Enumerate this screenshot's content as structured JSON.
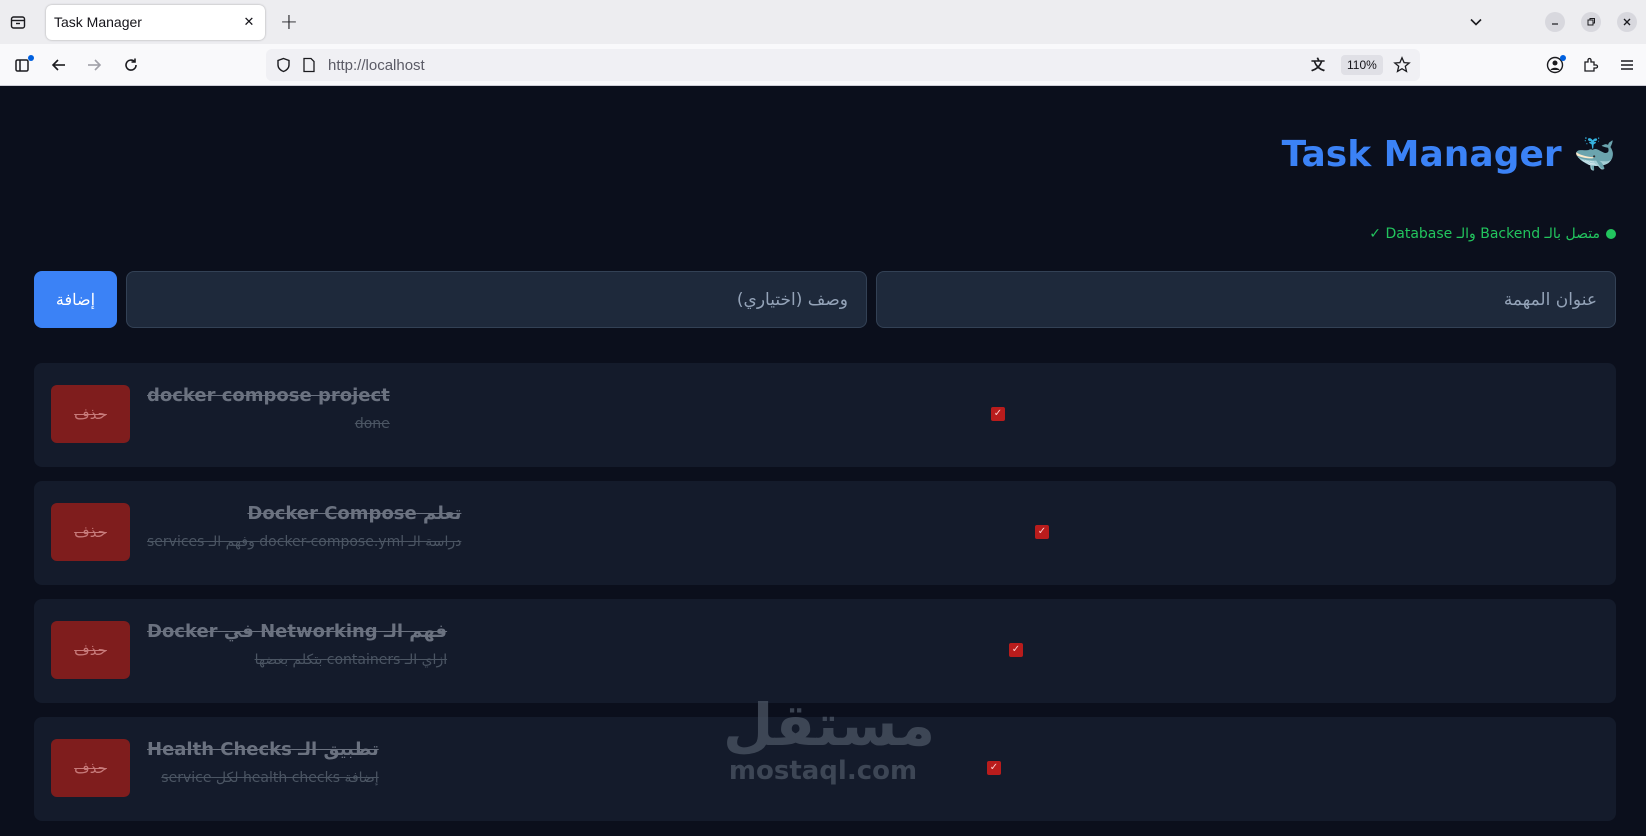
{
  "browser": {
    "tab_title": "Task Manager",
    "tab_close_glyph": "✕",
    "new_tab_glyph": "+",
    "url": "http://localhost",
    "zoom": "110%"
  },
  "app": {
    "title": "Task Manager",
    "title_icon": "🐳",
    "status_text": "متصل بالـ Backend والـ Database ✓",
    "status_color": "#22c55e",
    "accent_color": "#3b82f6",
    "form": {
      "title_placeholder": "عنوان المهمة",
      "description_placeholder": "وصف (اختياري)",
      "add_label": "إضافة"
    },
    "tasks": [
      {
        "title": "docker compose project",
        "description": "done",
        "completed": true,
        "delete_label": "حذف"
      },
      {
        "title": "تعلم Docker Compose",
        "description": "دراسة الـ docker-compose.yml وفهم الـ services",
        "completed": true,
        "delete_label": "حذف"
      },
      {
        "title": "فهم الـ Networking في Docker",
        "description": "ازاي الـ containers بتكلم بعضها",
        "completed": true,
        "delete_label": "حذف"
      },
      {
        "title": "تطبيق الـ Health Checks",
        "description": "إضافة health checks لكل service",
        "completed": true,
        "delete_label": "حذف"
      }
    ]
  },
  "watermark": {
    "arabic": "مستقل",
    "latin": "mostaql.com"
  }
}
